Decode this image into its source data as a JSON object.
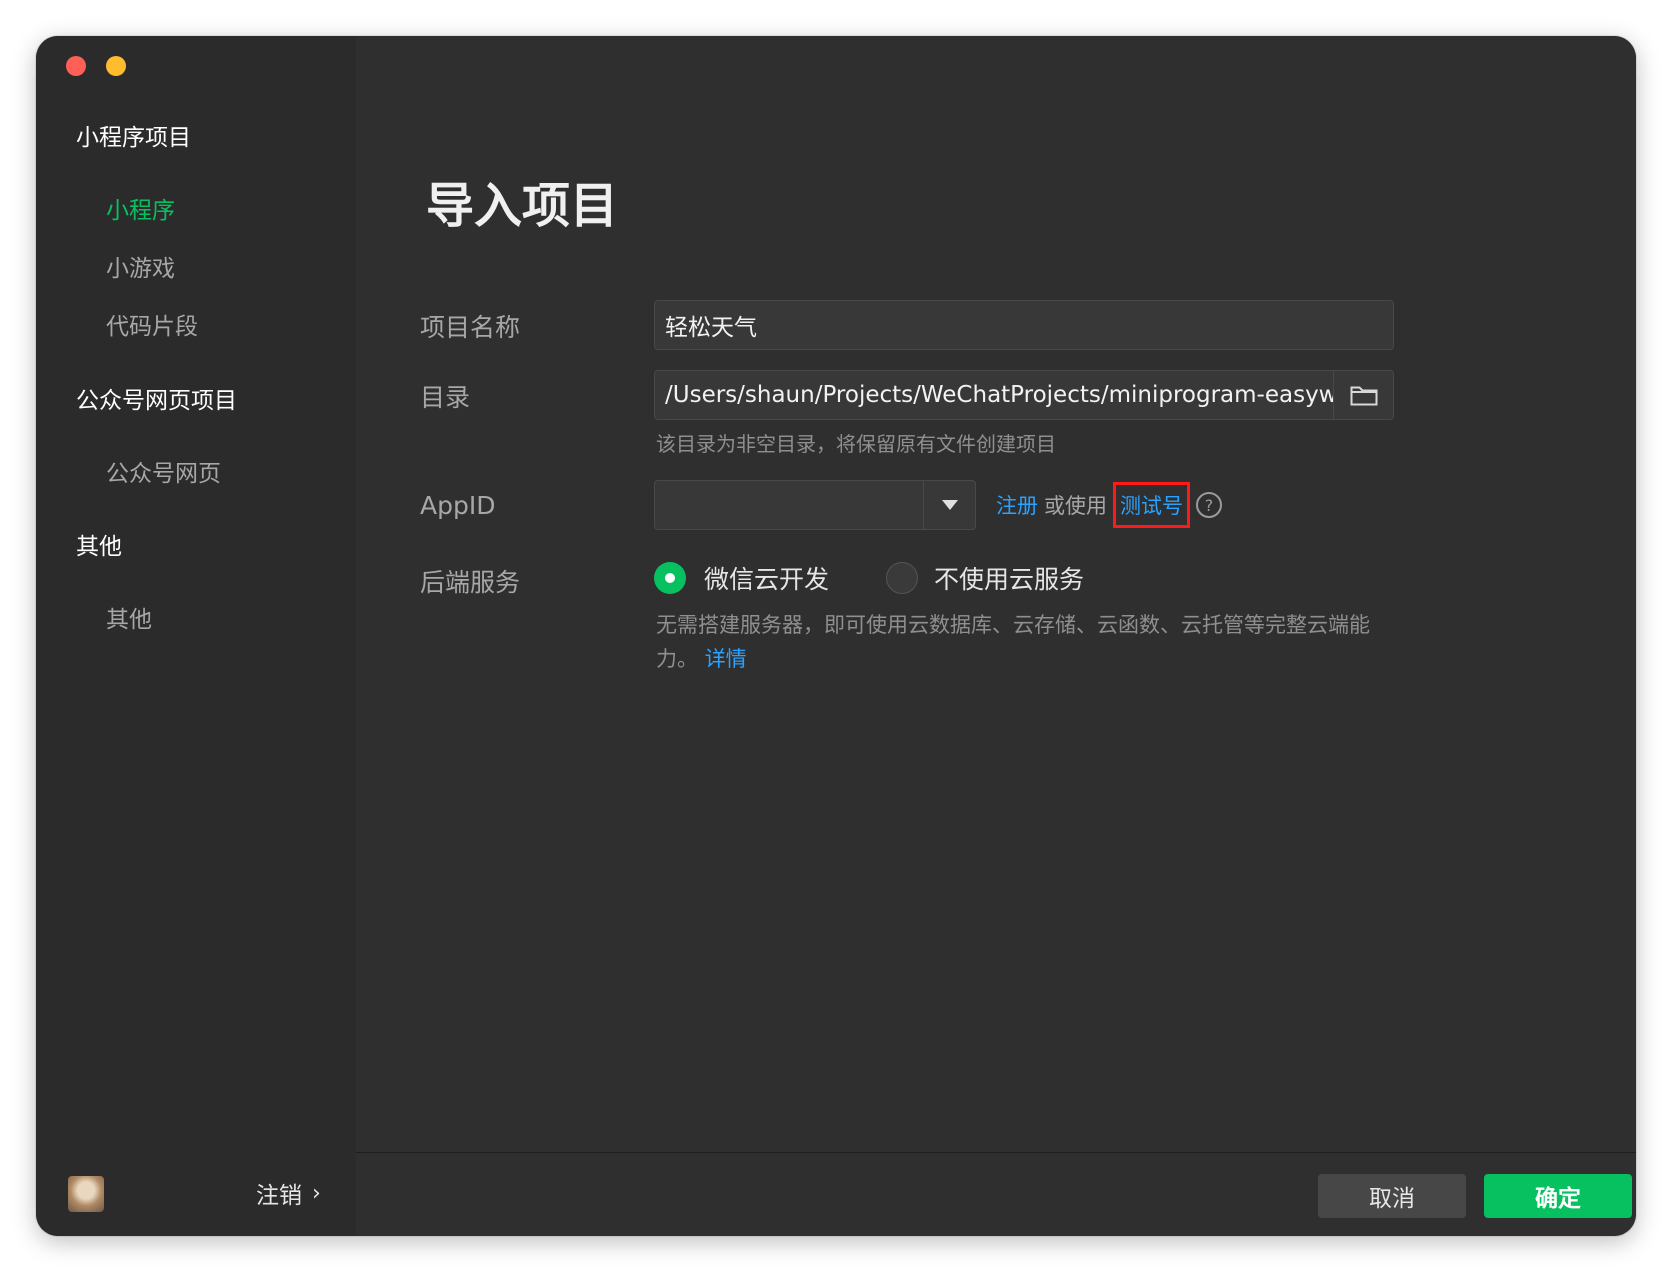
{
  "sidebar": {
    "groups": [
      {
        "label": "小程序项目",
        "items": [
          "小程序",
          "小游戏",
          "代码片段"
        ]
      },
      {
        "label": "公众号网页项目",
        "items": [
          "公众号网页"
        ]
      },
      {
        "label": "其他",
        "items": [
          "其他"
        ]
      }
    ],
    "active_item": "小程序",
    "logout_label": "注销"
  },
  "main": {
    "title": "导入项目",
    "fields": {
      "project_name": {
        "label": "项目名称",
        "value": "轻松天气"
      },
      "directory": {
        "label": "目录",
        "value": "/Users/shaun/Projects/WeChatProjects/miniprogram-easyweather",
        "hint": "该目录为非空目录，将保留原有文件创建项目"
      },
      "appid": {
        "label": "AppID",
        "value": "",
        "register_link": "注册",
        "or_text": "或使用",
        "test_link": "测试号",
        "help_icon": "question-circle-icon"
      },
      "backend": {
        "label": "后端服务",
        "options": [
          "微信云开发",
          "不使用云服务"
        ],
        "selected": "微信云开发",
        "description": "无需搭建服务器，即可使用云数据库、云存储、云函数、云托管等完整云端能力。",
        "details_link": "详情"
      }
    },
    "buttons": {
      "cancel": "取消",
      "confirm": "确定"
    }
  },
  "colors": {
    "accent_green": "#07c160",
    "link_blue": "#2aa2ff",
    "highlight_red": "#ff1a1a"
  }
}
